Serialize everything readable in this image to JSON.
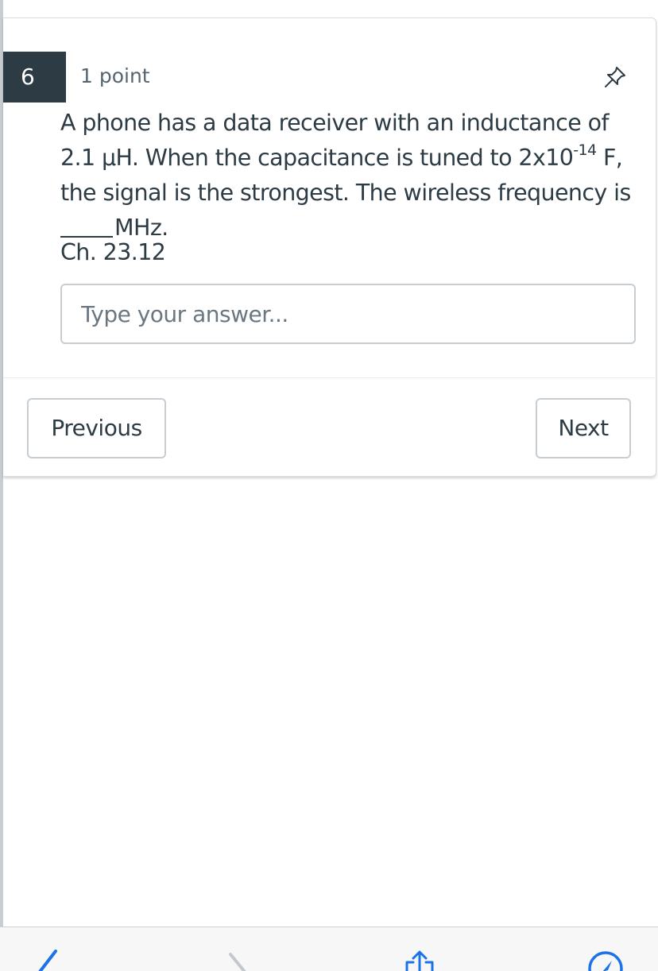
{
  "question": {
    "number": "6",
    "points": "1 point",
    "text_line1": "A phone has a data receiver with an inductance of",
    "text_line2_pre": "2.1 μH.  When the capacitance is tuned to 2x10",
    "text_line2_exp": "-14",
    "text_line2_post": " F,",
    "text_line3": "the signal is the strongest.  The wireless frequency is",
    "text_line4_blank": "____",
    "text_line4_post": "MHz.",
    "chapter": "Ch. 23.12",
    "answer_placeholder": "Type your answer...",
    "answer_value": ""
  },
  "navigation": {
    "previous_label": "Previous",
    "next_label": "Next"
  },
  "toolbar": {
    "icons": [
      "back-icon",
      "forward-icon",
      "share-icon",
      "compass-icon"
    ]
  },
  "colors": {
    "text": "#2d3b45",
    "number_badge_bg": "#2d3b45",
    "border": "#c7cdd1",
    "safari_blue": "#1a73e8"
  }
}
